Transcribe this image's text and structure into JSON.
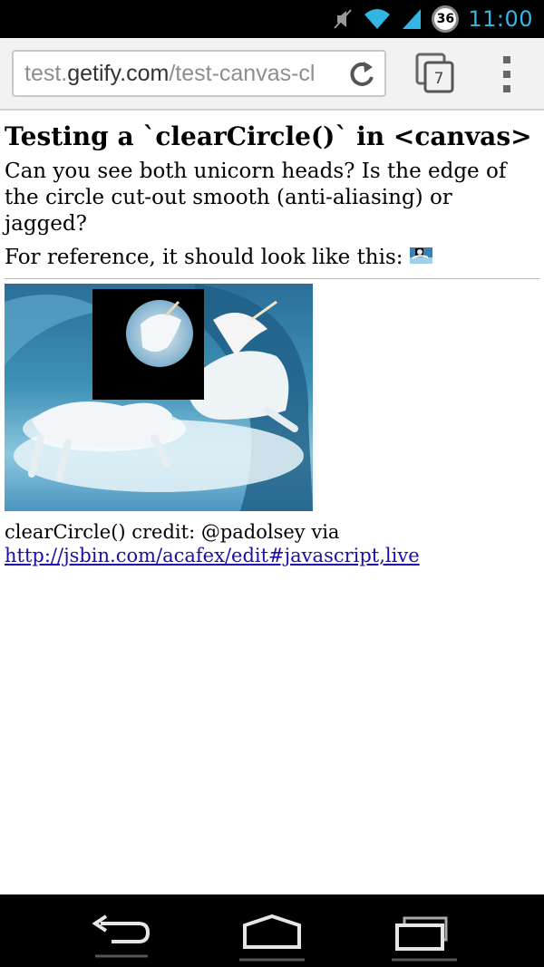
{
  "status_bar": {
    "time": "11:00",
    "battery_level": "36",
    "icons": [
      "mute-icon",
      "wifi-icon",
      "signal-icon",
      "battery-icon"
    ]
  },
  "browser": {
    "url_prefix": "test.",
    "url_domain": "getify.com",
    "url_path": "/test-canvas-cl",
    "tab_count": "7"
  },
  "page": {
    "title": "Testing a `clearCircle()` in <canvas>",
    "question": "Can you see both unicorn heads? Is the edge of the circle cut-out smooth (anti-aliasing) or jagged?",
    "reference_text": "For reference, it should look like this:",
    "credit_text": "clearCircle() credit: @padolsey via",
    "credit_link": "http://jsbin.com/acafex/edit#javascript,live"
  },
  "colors": {
    "link": "#1a0dab",
    "status_accent": "#33b5e5"
  }
}
